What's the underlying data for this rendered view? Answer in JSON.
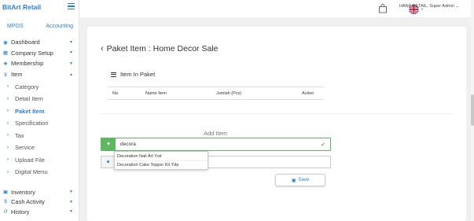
{
  "sidebar": {
    "brand": "BitArt Retail",
    "links": {
      "left": "MPOS",
      "right": "Accounting"
    },
    "menu": [
      {
        "label": "Dashboard",
        "icon": "dashboard-icon",
        "glyph": "◉"
      },
      {
        "label": "Company Setup",
        "icon": "building-icon",
        "glyph": "▦"
      },
      {
        "label": "Membership",
        "icon": "users-icon",
        "glyph": "❖"
      },
      {
        "label": "Item",
        "icon": "cart-icon",
        "glyph": "⊻"
      }
    ],
    "item_submenu": [
      "Category",
      "Detail Item",
      "Paket Item",
      "Specification",
      "Tax",
      "Service",
      "Upload File",
      "Digital Menu"
    ],
    "active_submenu": "Paket Item",
    "lower_menu": [
      {
        "label": "Inventory",
        "icon": "inventory-icon",
        "glyph": "▣"
      },
      {
        "label": "Cash Activity",
        "icon": "dollar-icon",
        "glyph": "$"
      },
      {
        "label": "History",
        "icon": "history-icon",
        "glyph": "↺"
      }
    ]
  },
  "topbar": {
    "user": "HANA RETAIL, Super Admin"
  },
  "page": {
    "title": "Paket Item : Home Decor Sale",
    "section_title": "Item In Paket",
    "table_headers": [
      "No.",
      "Name Item",
      "Jumlah (Pcs)",
      "Action"
    ],
    "add_item_title": "Add Item",
    "search_value": "decora",
    "suggestions": [
      "Decoration Nail Art Ywt",
      "Decoration Cake Topper Kit Ydp"
    ],
    "save_label": "Save"
  },
  "colors": {
    "accent": "#2b7fd1",
    "success": "#5fb85f"
  }
}
